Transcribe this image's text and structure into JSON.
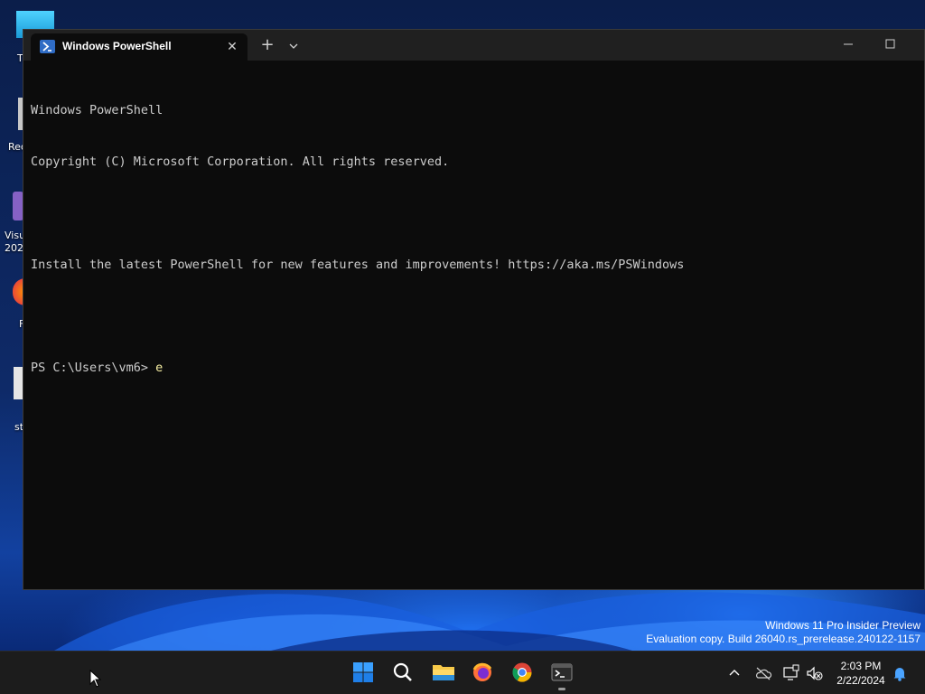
{
  "window": {
    "tab_title": "Windows PowerShell",
    "tab_close": "✕",
    "new_tab": "+"
  },
  "console": {
    "lines": [
      "Windows PowerShell",
      "Copyright (C) Microsoft Corporation. All rights reserved.",
      "",
      "Install the latest PowerShell for new features and improvements! https://aka.ms/PSWindows",
      ""
    ],
    "prompt": "PS C:\\Users\\vm6> ",
    "command": "e"
  },
  "desktop_icons": [
    {
      "label": "T"
    },
    {
      "label": "Rec"
    },
    {
      "label": "Visu"
    },
    {
      "label": "202"
    },
    {
      "label": "F"
    },
    {
      "label": "st"
    }
  ],
  "watermark": {
    "line1": "Windows 11 Pro Insider Preview",
    "line2": "Evaluation copy. Build 26040.rs_prerelease.240122-1157"
  },
  "taskbar": {
    "apps": [
      "start-icon",
      "search-icon",
      "file-explorer-icon",
      "firefox-icon",
      "chrome-icon",
      "terminal-icon"
    ],
    "tray": [
      "chevron-up-icon",
      "onedrive-icon",
      "display-icon",
      "speaker-muted-icon"
    ],
    "time": "2:03 PM",
    "date": "2/22/2024"
  },
  "colors": {
    "console_bg": "#0c0c0c",
    "console_text": "#cccccc",
    "command_text": "#f9f1a5",
    "titlebar": "#202020",
    "taskbar": "#1c1c1c"
  }
}
